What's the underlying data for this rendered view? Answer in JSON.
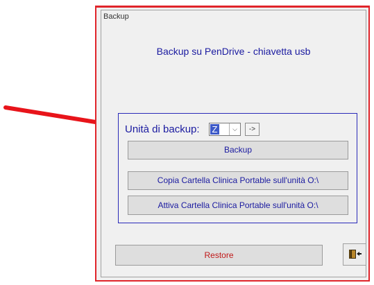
{
  "window": {
    "title": "Backup"
  },
  "header": {
    "title": "Backup su PenDrive - chiavetta usb"
  },
  "drive": {
    "label": "Unità di backup:",
    "selected": "Z",
    "go_label": "->"
  },
  "buttons": {
    "backup": "Backup",
    "copia": "Copia Cartella Clinica Portable sull'unità O:\\",
    "attiva": "Attiva Cartella Clinica Portable sull'unità O:\\",
    "restore": "Restore"
  },
  "colors": {
    "annotation_arrow": "#e8141a",
    "label_blue": "#1a1aa0",
    "restore_red": "#c01818"
  },
  "icons": {
    "dropdown": "chevron-down-icon",
    "exit": "exit-door-icon",
    "annotation": "red-arrow-annotation"
  }
}
